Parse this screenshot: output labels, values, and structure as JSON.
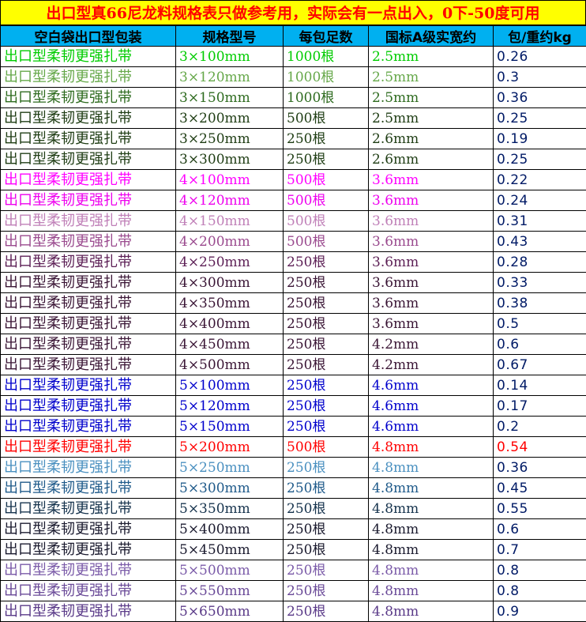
{
  "title": "出口型真66尼龙料规格表只做参考用，实际会有一点出入，0下-50度可用",
  "headers": [
    "空白袋出口型包装",
    "规格型号",
    "每包足数",
    "国标A级实宽约",
    "包/重约kg"
  ],
  "rows": [
    {
      "name": "出口型柔韧更强扎带",
      "spec": "3×100mm",
      "qty": "1000根",
      "width": "2.5mm",
      "weight": "0.26",
      "color": "#00cc00"
    },
    {
      "name": "出口型柔韧更强扎带",
      "spec": "3×120mm",
      "qty": "1000根",
      "width": "2.5mm",
      "weight": "0.3",
      "color": "#66a84a"
    },
    {
      "name": "出口型柔韧更强扎带",
      "spec": "3×150mm",
      "qty": "1000根",
      "width": "2.5mm",
      "weight": "0.36",
      "color": "#2e6b1f"
    },
    {
      "name": "出口型柔韧更强扎带",
      "spec": "3×200mm",
      "qty": "500根",
      "width": "2.5mm",
      "weight": "0.25",
      "color": "#1f3d14"
    },
    {
      "name": "出口型柔韧更强扎带",
      "spec": "3×250mm",
      "qty": "250根",
      "width": "2.6mm",
      "weight": "0.19",
      "color": "#1f3d14"
    },
    {
      "name": "出口型柔韧更强扎带",
      "spec": "3×300mm",
      "qty": "250根",
      "width": "2.6mm",
      "weight": "0.25",
      "color": "#1f3d14"
    },
    {
      "name": "出口型柔韧更强扎带",
      "spec": "4×100mm",
      "qty": "500根",
      "width": "3.6mm",
      "weight": "0.22",
      "color": "#ff00ff"
    },
    {
      "name": "出口型柔韧更强扎带",
      "spec": "4×120mm",
      "qty": "500根",
      "width": "3.6mm",
      "weight": "0.24",
      "color": "#ee00ee"
    },
    {
      "name": "出口型柔韧更强扎带",
      "spec": "4×150mm",
      "qty": "500根",
      "width": "3.6mm",
      "weight": "0.31",
      "color": "#c080b8"
    },
    {
      "name": "出口型柔韧更强扎带",
      "spec": "4×200mm",
      "qty": "500根",
      "width": "3.6mm",
      "weight": "0.43",
      "color": "#9a4a8e"
    },
    {
      "name": "出口型柔韧更强扎带",
      "spec": "4×250mm",
      "qty": "250根",
      "width": "3.6mm",
      "weight": "0.28",
      "color": "#5c1f55"
    },
    {
      "name": "出口型柔韧更强扎带",
      "spec": "4×300mm",
      "qty": "250根",
      "width": "3.6mm",
      "weight": "0.33",
      "color": "#3a1535"
    },
    {
      "name": "出口型柔韧更强扎带",
      "spec": "4×350mm",
      "qty": "250根",
      "width": "3.6mm",
      "weight": "0.38",
      "color": "#3a1535"
    },
    {
      "name": "出口型柔韧更强扎带",
      "spec": "4×400mm",
      "qty": "250根",
      "width": "3.6mm",
      "weight": "0.5",
      "color": "#3a1535"
    },
    {
      "name": "出口型柔韧更强扎带",
      "spec": "4×450mm",
      "qty": "250根",
      "width": "4.2mm",
      "weight": "0.6",
      "color": "#3a1535"
    },
    {
      "name": "出口型柔韧更强扎带",
      "spec": "4×500mm",
      "qty": "250根",
      "width": "4.2mm",
      "weight": "0.67",
      "color": "#3a1535"
    },
    {
      "name": "出口型柔韧更强扎带",
      "spec": "5×100mm",
      "qty": "250根",
      "width": "4.6mm",
      "weight": "0.14",
      "color": "#0000cc"
    },
    {
      "name": "出口型柔韧更强扎带",
      "spec": "5×120mm",
      "qty": "250根",
      "width": "4.6mm",
      "weight": "0.17",
      "color": "#0000cc"
    },
    {
      "name": "出口型柔韧更强扎带",
      "spec": "5×150mm",
      "qty": "250根",
      "width": "4.6mm",
      "weight": "0.2",
      "color": "#0000cc"
    },
    {
      "name": "出口型柔韧更强扎带",
      "spec": "5×200mm",
      "qty": "500根",
      "width": "4.8mm",
      "weight": "0.54",
      "color": "#ff0000"
    },
    {
      "name": "出口型柔韧更强扎带",
      "spec": "5×250mm",
      "qty": "250根",
      "width": "4.8mm",
      "weight": "0.36",
      "color": "#4a90c0"
    },
    {
      "name": "出口型柔韧更强扎带",
      "spec": "5×300mm",
      "qty": "250根",
      "width": "4.8mm",
      "weight": "0.45",
      "color": "#1f5a8a"
    },
    {
      "name": "出口型柔韧更强扎带",
      "spec": "5×350mm",
      "qty": "250根",
      "width": "4.8mm",
      "weight": "0.55",
      "color": "#16334d"
    },
    {
      "name": "出口型柔韧更强扎带",
      "spec": "5×400mm",
      "qty": "250根",
      "width": "4.8mm",
      "weight": "0.6",
      "color": "#1a1a2e"
    },
    {
      "name": "出口型柔韧更强扎带",
      "spec": "5×450mm",
      "qty": "250根",
      "width": "4.8mm",
      "weight": "0.7",
      "color": "#1a1a2e"
    },
    {
      "name": "出口型柔韧更强扎带",
      "spec": "5×500mm",
      "qty": "250根",
      "width": "4.8mm",
      "weight": "0.8",
      "color": "#7a5aa8"
    },
    {
      "name": "出口型柔韧更强扎带",
      "spec": "5×550mm",
      "qty": "250根",
      "width": "4.8mm",
      "weight": "0.8",
      "color": "#6a4a98"
    },
    {
      "name": "出口型柔韧更强扎带",
      "spec": "5×650mm",
      "qty": "250根",
      "width": "4.8mm",
      "weight": "0.9",
      "color": "#5a3a88"
    }
  ]
}
